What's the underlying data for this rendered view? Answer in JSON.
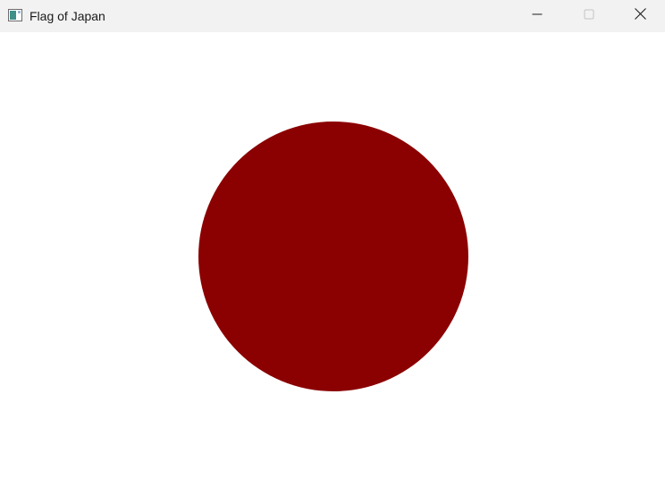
{
  "window": {
    "title": "Flag of Japan",
    "app_icon": "window-app-icon",
    "controls": {
      "minimize_icon": "minimize-icon",
      "maximize_icon": "maximize-icon",
      "close_icon": "close-icon"
    }
  },
  "flag": {
    "background_color": "#ffffff",
    "disc_color": "#8b0000"
  },
  "colors": {
    "titlebar": "#f2f2f2",
    "title_text": "#1a1a1a"
  }
}
